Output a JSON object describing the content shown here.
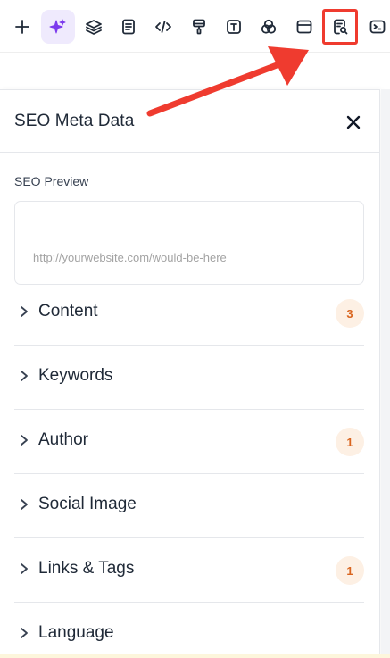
{
  "toolbar": {
    "buttons": [
      {
        "icon": "plus-icon"
      },
      {
        "icon": "sparkles-icon",
        "active": true
      },
      {
        "icon": "layers-icon"
      },
      {
        "icon": "page-icon"
      },
      {
        "icon": "code-icon"
      },
      {
        "icon": "paint-roller-icon"
      },
      {
        "icon": "text-icon"
      },
      {
        "icon": "circles-icon"
      },
      {
        "icon": "browser-window-icon"
      },
      {
        "icon": "seo-search-icon",
        "highlighted": true
      },
      {
        "icon": "terminal-icon"
      }
    ]
  },
  "panel": {
    "title": "SEO Meta Data",
    "preview": {
      "label": "SEO Preview",
      "url": "http://yourwebsite.com/would-be-here"
    },
    "sections": [
      {
        "label": "Content",
        "badge": "3"
      },
      {
        "label": "Keywords",
        "badge": ""
      },
      {
        "label": "Author",
        "badge": "1"
      },
      {
        "label": "Social Image",
        "badge": ""
      },
      {
        "label": "Links & Tags",
        "badge": "1"
      },
      {
        "label": "Language",
        "badge": ""
      }
    ]
  },
  "colors": {
    "accent": "#7c3aed",
    "annotation": "#ef3b2f",
    "badge_bg": "#fdf0e4",
    "badge_text": "#d9651f"
  }
}
